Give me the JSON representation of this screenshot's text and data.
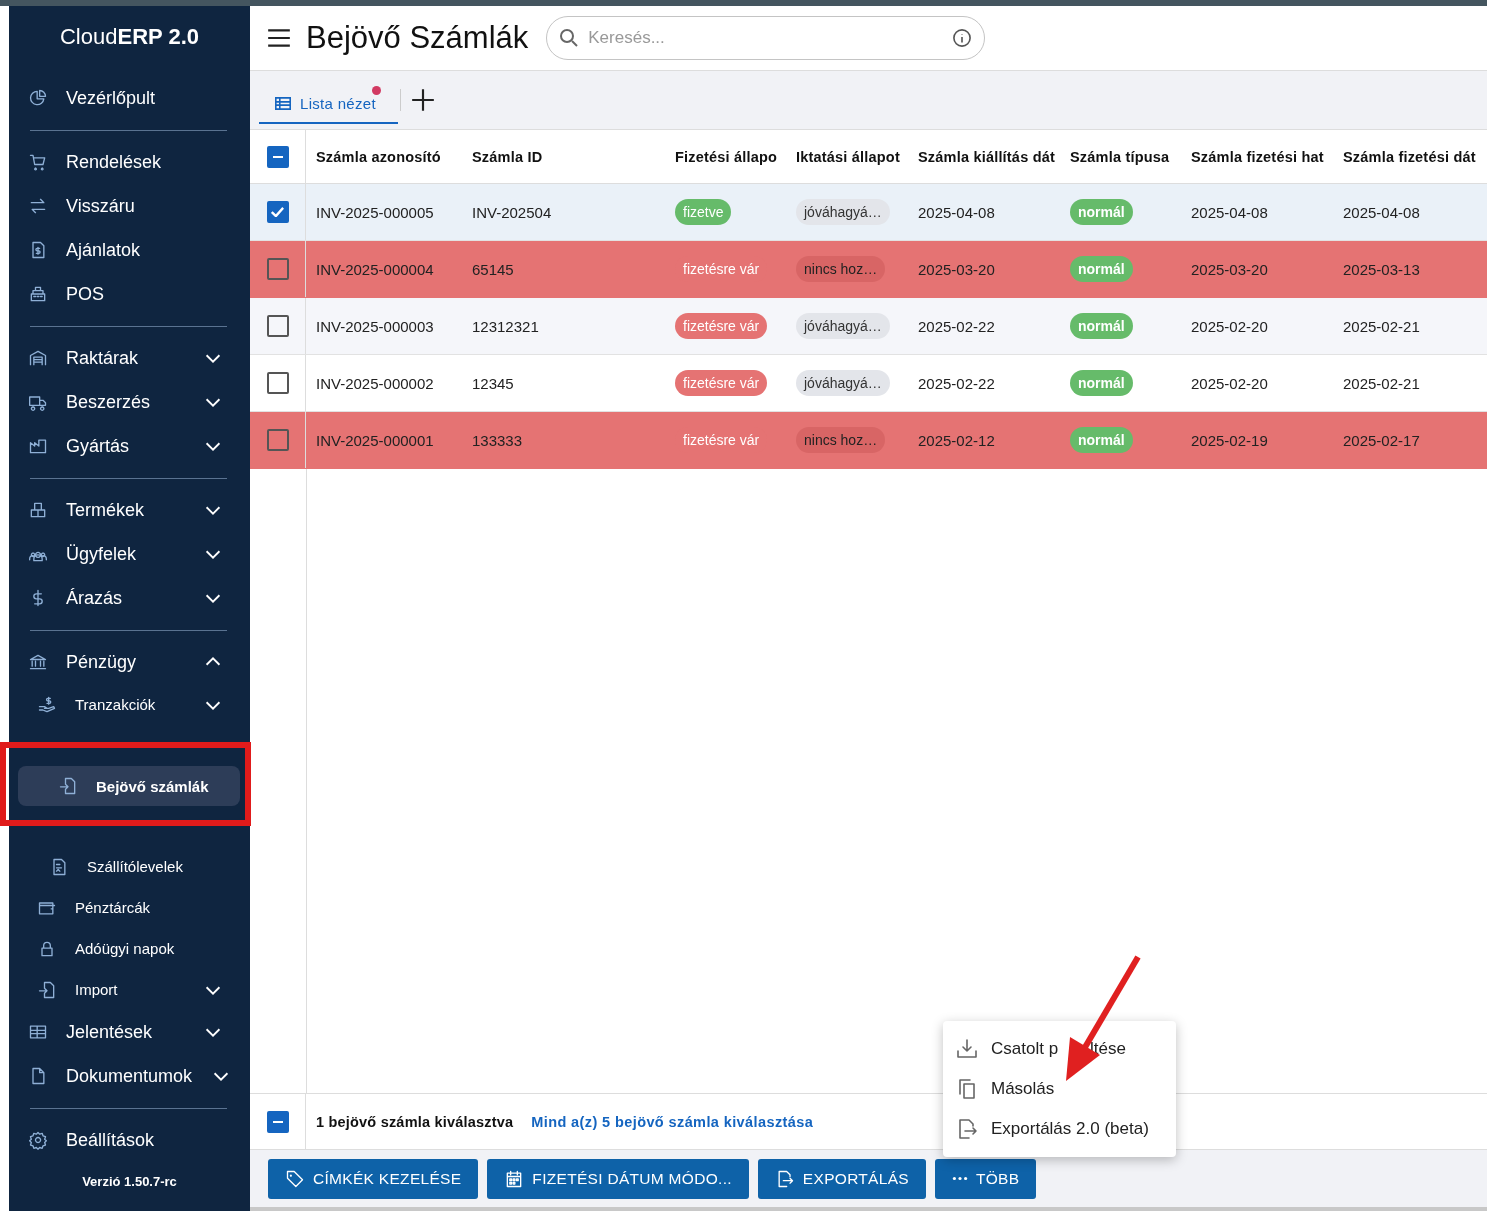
{
  "app": {
    "logo_regular": "Cloud",
    "logo_bold": "ERP 2.0",
    "version": "Verzió 1.50.7-rc"
  },
  "sidebar": {
    "sections": [
      [
        {
          "label": "Vezérlőpult",
          "selected": false
        }
      ],
      [
        {
          "label": "Rendelések",
          "selected": false
        },
        {
          "label": "Visszáru",
          "selected": false
        },
        {
          "label": "Ajánlatok",
          "selected": false
        },
        {
          "label": "POS",
          "selected": false
        }
      ],
      [
        {
          "label": "Raktárak",
          "selected": false,
          "expanded": false
        },
        {
          "label": "Beszerzés",
          "selected": false,
          "expanded": false
        },
        {
          "label": "Gyártás",
          "selected": false,
          "expanded": false
        }
      ],
      [
        {
          "label": "Termékek",
          "selected": false,
          "expanded": false
        },
        {
          "label": "Ügyfelek",
          "selected": false,
          "expanded": false
        },
        {
          "label": "Árazás",
          "selected": false,
          "expanded": false
        }
      ],
      [
        {
          "label": "Pénzügy",
          "selected": false,
          "expanded": true,
          "children": [
            {
              "label": "Tranzakciók",
              "selected": false,
              "expanded": false
            },
            {
              "children": [
                {
                  "label": "Bejövő számlák",
                  "selected": true
                },
                {
                  "label": "Szállítólevelek",
                  "selected": false
                }
              ]
            },
            {
              "label": "Pénztárcák",
              "selected": false
            },
            {
              "label": "Adóügyi napok",
              "selected": false
            },
            {
              "label": "Import",
              "selected": false,
              "expanded": false
            }
          ]
        },
        {
          "label": "Jelentések",
          "selected": false,
          "expanded": false
        },
        {
          "label": "Dokumentumok",
          "selected": false,
          "expanded": false
        }
      ],
      [
        {
          "label": "Beállítások",
          "selected": false
        }
      ]
    ]
  },
  "page": {
    "title": "Bejövő Számlák",
    "search_placeholder": "Keresés..."
  },
  "views": [
    {
      "label": "Lista nézet",
      "selected": true,
      "unread": true
    }
  ],
  "table": {
    "select_all_indeterminate": true,
    "columns": [
      "Számla azonosító",
      "Számla ID",
      "Fizetési állapo",
      "Iktatási állapot",
      "Számla kiállítás dát",
      "Számla típusa",
      "Számla fizetési hat",
      "Számla fizetési dát"
    ],
    "rows": [
      {
        "checked": true,
        "overdue": false,
        "id": "INV-2025-000005",
        "invoice_no": "INV-202504",
        "payment": {
          "label": "fizetve",
          "kind": "paid"
        },
        "filing": {
          "label": "jóváhagyá…",
          "kind": "approved"
        },
        "issued": "2025-04-08",
        "type": "normál",
        "due": "2025-04-08",
        "paid_date": "2025-04-08"
      },
      {
        "checked": false,
        "overdue": true,
        "id": "INV-2025-000004",
        "invoice_no": "65145",
        "payment": {
          "label": "fizetésre vár",
          "kind": "unpaid"
        },
        "filing": {
          "label": "nincs hoz…",
          "kind": "missing"
        },
        "issued": "2025-03-20",
        "type": "normál",
        "due": "2025-03-20",
        "paid_date": "2025-03-13"
      },
      {
        "checked": false,
        "overdue": false,
        "id": "INV-2025-000003",
        "invoice_no": "12312321",
        "payment": {
          "label": "fizetésre vár",
          "kind": "unpaid"
        },
        "filing": {
          "label": "jóváhagyá…",
          "kind": "approved"
        },
        "issued": "2025-02-22",
        "type": "normál",
        "due": "2025-02-20",
        "paid_date": "2025-02-21"
      },
      {
        "checked": false,
        "overdue": false,
        "id": "INV-2025-000002",
        "invoice_no": "12345",
        "payment": {
          "label": "fizetésre vár",
          "kind": "unpaid"
        },
        "filing": {
          "label": "jóváhagyá…",
          "kind": "approved"
        },
        "issued": "2025-02-22",
        "type": "normál",
        "due": "2025-02-20",
        "paid_date": "2025-02-21"
      },
      {
        "checked": false,
        "overdue": true,
        "id": "INV-2025-000001",
        "invoice_no": "133333",
        "payment": {
          "label": "fizetésre vár",
          "kind": "unpaid"
        },
        "filing": {
          "label": "nincs hoz…",
          "kind": "missing"
        },
        "issued": "2025-02-12",
        "type": "normál",
        "due": "2025-02-19",
        "paid_date": "2025-02-17"
      }
    ]
  },
  "selection": {
    "indeterminate": true,
    "count_text": "1 bejövő számla kiválasztva",
    "select_all_link": "Mind a(z) 5 bejövő számla kiválasztása"
  },
  "actions": [
    {
      "label": "CÍMKÉK KEZELÉSE"
    },
    {
      "label": "FIZETÉSI DÁTUM MÓDO..."
    },
    {
      "label": "EXPORTÁLÁS"
    },
    {
      "label": "TÖBB"
    }
  ],
  "more_menu": {
    "open": true,
    "items": [
      {
        "label": "Csatolt p",
        "label_tail": "ltése"
      },
      {
        "label": "Másolás"
      },
      {
        "label": "Exportálás 2.0 (beta)"
      }
    ]
  },
  "annotations": {
    "box_around_selected": true,
    "arrow_to_menu": true
  }
}
